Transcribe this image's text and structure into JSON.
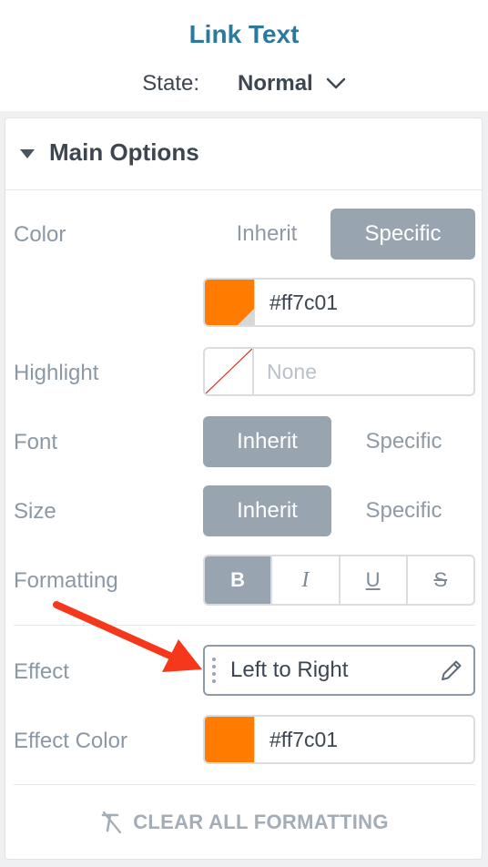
{
  "header": {
    "title": "Link Text",
    "state_label": "State:",
    "state_value": "Normal"
  },
  "section": {
    "title": "Main Options"
  },
  "color": {
    "label": "Color",
    "options": [
      "Inherit",
      "Specific"
    ],
    "selected": "Specific",
    "value": "#ff7c01"
  },
  "highlight": {
    "label": "Highlight",
    "placeholder": "None"
  },
  "font": {
    "label": "Font",
    "options": [
      "Inherit",
      "Specific"
    ],
    "selected": "Inherit"
  },
  "size": {
    "label": "Size",
    "options": [
      "Inherit",
      "Specific"
    ],
    "selected": "Inherit"
  },
  "formatting": {
    "label": "Formatting",
    "buttons": [
      "B",
      "I",
      "U",
      "S"
    ],
    "active": "B"
  },
  "effect": {
    "label": "Effect",
    "value": "Left to Right"
  },
  "effect_color": {
    "label": "Effect Color",
    "value": "#ff7c01"
  },
  "clear_label": "CLEAR ALL FORMATTING",
  "colors": {
    "accent": "#ff7c01",
    "title": "#2b7a9c",
    "active_segment": "#98a5b1",
    "annotation_arrow": "#f5371b"
  },
  "icons": [
    "chevron-down-icon",
    "caret-down-icon",
    "grip-icon",
    "pencil-icon",
    "clear-format-icon",
    "annotation-arrow"
  ]
}
